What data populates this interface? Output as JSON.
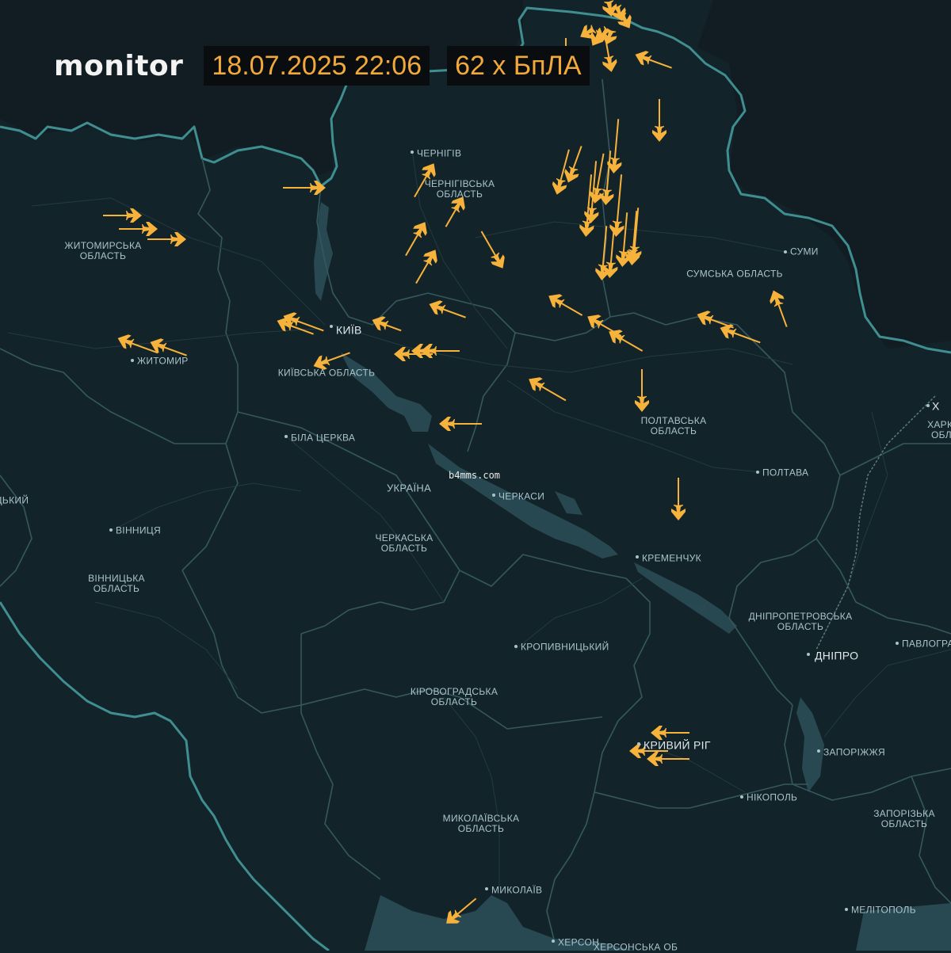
{
  "header": {
    "brand": "monitor",
    "datetime": "18.07.2025 22:06",
    "count": "62 x БпЛА"
  },
  "colors": {
    "background": "#13232a",
    "border": "#3e8a8c",
    "drone": "#f6b23a",
    "label": "#a9c4cc"
  },
  "watermark": "b4mms.com",
  "regions": [
    {
      "name": "ЖИТОМИРСЬКА\nОБЛАСТЬ"
    },
    {
      "name": "ЧЕРНІГІВСЬКА\nОБЛАСТЬ"
    },
    {
      "name": "СУМСЬКА ОБЛАСТЬ"
    },
    {
      "name": "КИЇВСЬКА ОБЛАСТЬ"
    },
    {
      "name": "ПОЛТАВСЬКА\nОБЛАСТЬ"
    },
    {
      "name": "ХАРКІ\nОБЛ"
    },
    {
      "name": "ЧЕРКАСЬКА\nОБЛАСТЬ"
    },
    {
      "name": "ВІННИЦЬКА\nОБЛАСТЬ"
    },
    {
      "name": "КІРОВОГРАДСЬКА\nОБЛАСТЬ"
    },
    {
      "name": "ДНІПРОПЕТРОВСЬКА\nОБЛАСТЬ"
    },
    {
      "name": "МИКОЛАЇВСЬКА\nОБЛАСТЬ"
    },
    {
      "name": "ЗАПОРІЗЬКА\nОБЛАСТЬ"
    },
    {
      "name": "ХЕРСОНСЬКА ОБ"
    },
    {
      "name": "УКРАЇНА"
    },
    {
      "name": "ЦЬКИЙ"
    }
  ],
  "cities": [
    {
      "name": "ЧЕРНІГІВ"
    },
    {
      "name": "СУМИ"
    },
    {
      "name": "КИЇВ"
    },
    {
      "name": "ЖИТОМИР"
    },
    {
      "name": "БІЛА ЦЕРКВА"
    },
    {
      "name": "ПОЛТАВА"
    },
    {
      "name": "ЧЕРКАСИ"
    },
    {
      "name": "ВІННИЦЯ"
    },
    {
      "name": "КРЕМЕНЧУК"
    },
    {
      "name": "КРОПИВНИЦЬКИЙ"
    },
    {
      "name": "ДНІПРО"
    },
    {
      "name": "ПАВЛОГРАД"
    },
    {
      "name": "КРИВИЙ РІГ"
    },
    {
      "name": "ЗАПОРІЖЖЯ"
    },
    {
      "name": "НІКОПОЛЬ"
    },
    {
      "name": "МИКОЛАЇВ"
    },
    {
      "name": "МЕЛІТОПОЛЬ"
    },
    {
      "name": "ХЕРСОН"
    },
    {
      "name": "Х"
    }
  ]
}
